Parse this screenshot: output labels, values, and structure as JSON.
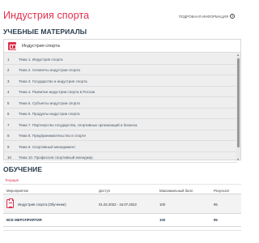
{
  "page": {
    "title": "Индустрия спорта",
    "more_info": "ПОДРОБНАЯ ИНФОРМАЦИЯ",
    "info_icon": "info-circle-icon"
  },
  "materials": {
    "heading": "УЧЕБНЫЕ МАТЕРИАЛЫ",
    "course_name": "Индустрия спорта",
    "course_icon": "book-icon",
    "topics": [
      {
        "num": "1",
        "label": "Тема 1. Индустрия спорта"
      },
      {
        "num": "2",
        "label": "Тема 2. Сегменты индустрии спорта"
      },
      {
        "num": "3",
        "label": "Тема 3. Государство и индустрия спорта"
      },
      {
        "num": "4",
        "label": "Тема 4. Развитие индустрии спорта в России"
      },
      {
        "num": "5",
        "label": "Тема 5. Субъекты индустрии спорта"
      },
      {
        "num": "6",
        "label": "Тема 6. Продукты индустрии спорта"
      },
      {
        "num": "7",
        "label": "Тема 7. Партнерство государства, спортивных организаций и бизнеса"
      },
      {
        "num": "8",
        "label": "Тема 8. Предпринимательство в спорте"
      },
      {
        "num": "9",
        "label": "Тема 9. Спортивный менеджмент"
      },
      {
        "num": "10",
        "label": "Тема 10. Профессия спортивный менеджер"
      }
    ]
  },
  "training": {
    "heading": "ОБУЧЕНИЕ",
    "tab_current": "Текущие",
    "columns": {
      "event": "Мероприятие",
      "access": "Доступ",
      "max_score": "Максимальный балл",
      "result": "Результат"
    },
    "rows": [
      {
        "event": "Индустрия спорта (Обучение)",
        "access": "01.02.2022 - 16.07.2022",
        "max_score": "100",
        "result": "95"
      }
    ],
    "total": {
      "label": "ВСЕ МЕРОПРИЯТИЯ",
      "max_score": "100",
      "result": "95"
    }
  },
  "colors": {
    "accent": "#e0304c",
    "heading": "#2a3b4c"
  }
}
